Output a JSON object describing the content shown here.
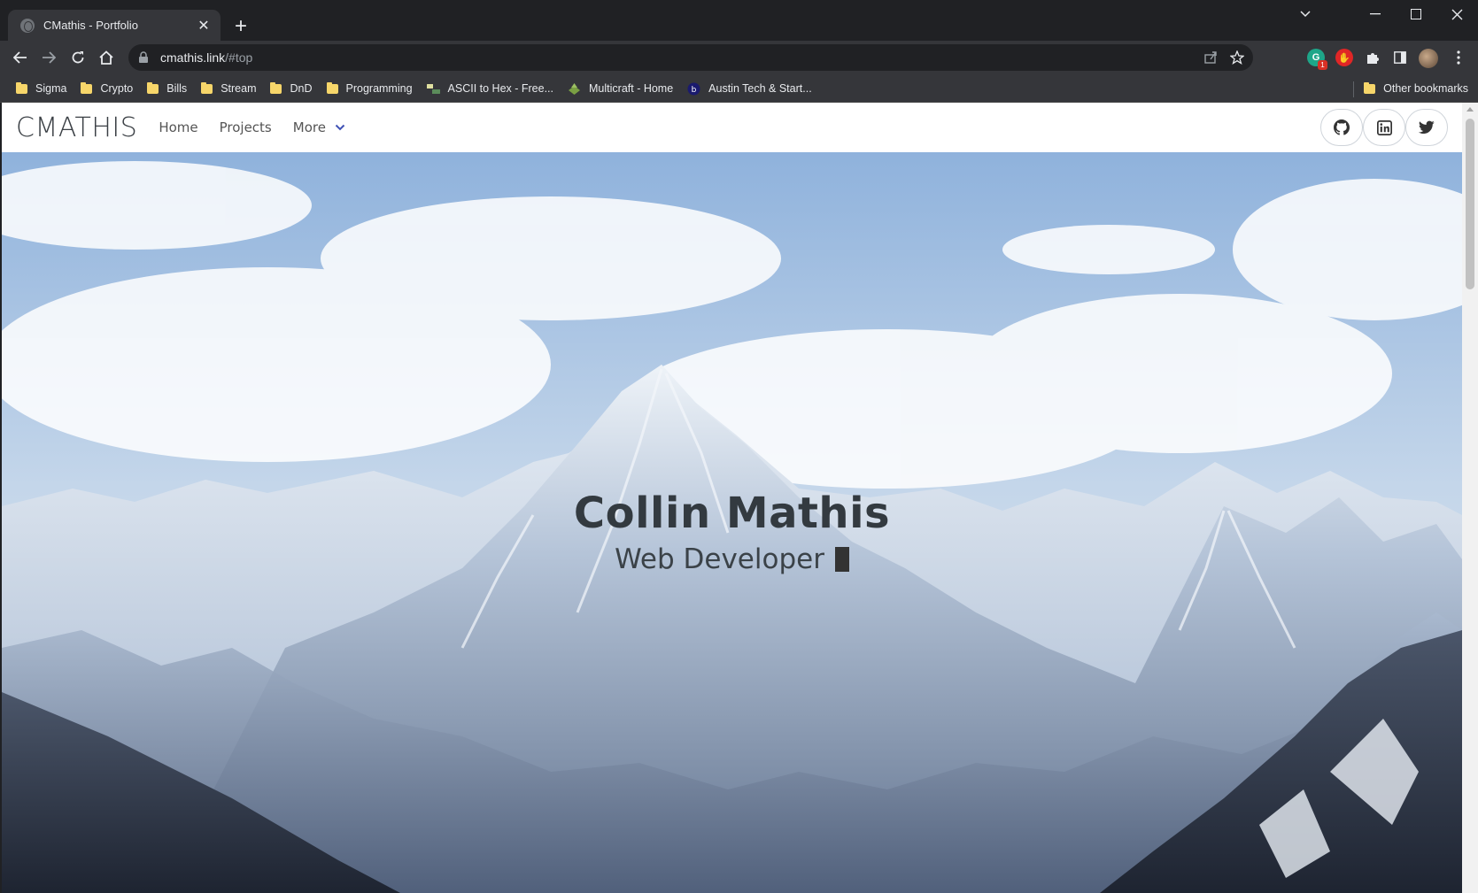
{
  "browser": {
    "tab_title": "CMathis - Portfolio",
    "url_host": "cmathis.link",
    "url_path": "/#top",
    "extension_badge": "1",
    "bookmarks": [
      {
        "label": "Sigma",
        "icon": "folder-icon"
      },
      {
        "label": "Crypto",
        "icon": "folder-icon"
      },
      {
        "label": "Bills",
        "icon": "folder-icon"
      },
      {
        "label": "Stream",
        "icon": "folder-icon"
      },
      {
        "label": "DnD",
        "icon": "folder-icon"
      },
      {
        "label": "Programming",
        "icon": "folder-icon"
      },
      {
        "label": "ASCII to Hex - Free...",
        "icon": "ascii-hex-favicon"
      },
      {
        "label": "Multicraft - Home",
        "icon": "multicraft-favicon"
      },
      {
        "label": "Austin Tech & Start...",
        "icon": "austin-tech-favicon"
      }
    ],
    "other_bookmarks": "Other bookmarks"
  },
  "site": {
    "brand": "CMATHIS",
    "nav": {
      "home": "Home",
      "projects": "Projects",
      "more": "More"
    },
    "social": [
      "github-icon",
      "linkedin-icon",
      "twitter-icon"
    ],
    "hero": {
      "name": "Collin Mathis",
      "role": "Web Developer"
    }
  },
  "colors": {
    "chrome_dark": "#202124",
    "chrome_toolbar": "#35363a",
    "nav_accent": "#3f51b5",
    "hero_text": "#333a40"
  }
}
